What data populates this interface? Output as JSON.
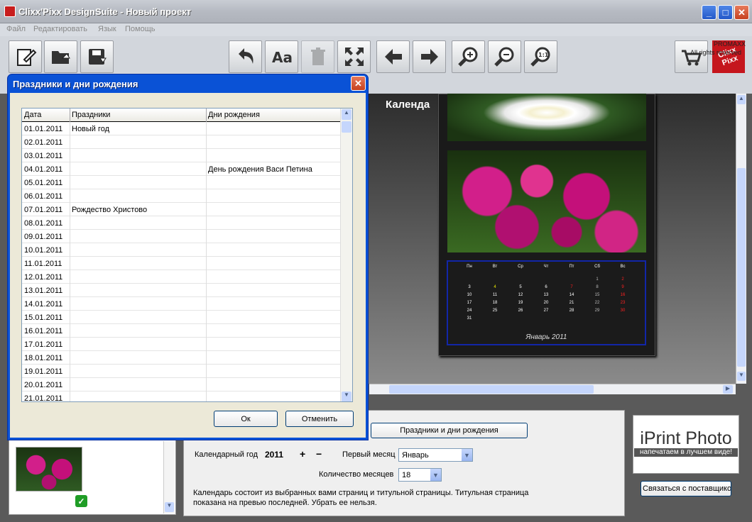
{
  "window": {
    "title": "Clixx'Pixx DesignSuite - Новый проект"
  },
  "menu": [
    "Файл",
    "Редактировать",
    "Язык",
    "Помощь"
  ],
  "brand": {
    "logo_text": "Clixx Pixx",
    "company": "PROMAXX",
    "rights": "All rights reserved"
  },
  "preview": {
    "heading": "Календа",
    "weekdays": [
      "Пн",
      "Вт",
      "Ср",
      "Чт",
      "Пт",
      "Сб",
      "Вс"
    ],
    "weeks": [
      [
        "",
        "",
        "",
        "",
        "",
        "1",
        "2"
      ],
      [
        "3",
        "4",
        "5",
        "6",
        "7",
        "8",
        "9"
      ],
      [
        "10",
        "11",
        "12",
        "13",
        "14",
        "15",
        "16"
      ],
      [
        "17",
        "18",
        "19",
        "20",
        "21",
        "22",
        "23"
      ],
      [
        "24",
        "25",
        "26",
        "27",
        "28",
        "29",
        "30"
      ],
      [
        "31",
        "",
        "",
        "",
        "",
        "",
        ""
      ]
    ],
    "month_label": "Январь 2011"
  },
  "settings": {
    "holidays_button": "Праздники и дни рождения",
    "year_label": "Календарный год",
    "year_value": "2011",
    "plus": "+",
    "minus": "−",
    "first_month_label": "Первый месяц",
    "first_month_value": "Январь",
    "months_count_label": "Количество месяцев",
    "months_count_value": "18",
    "info_text": "Календарь состоит из выбранных вами страниц и титульной страницы. Титульная страница показана на превью последней. Убрать ее нельзя."
  },
  "supplier": {
    "logo": "iPrint Photo",
    "tagline": "напечатаем в лучшем виде!",
    "contact_button": "Связаться с поставщиком"
  },
  "dialog": {
    "title": "Праздники и дни рождения",
    "columns": [
      "Дата",
      "Праздники",
      "Дни рождения"
    ],
    "rows": [
      [
        "01.01.2011",
        "Новый год",
        ""
      ],
      [
        "02.01.2011",
        "",
        ""
      ],
      [
        "03.01.2011",
        "",
        ""
      ],
      [
        "04.01.2011",
        "",
        "День рождения Васи Петина"
      ],
      [
        "05.01.2011",
        "",
        ""
      ],
      [
        "06.01.2011",
        "",
        ""
      ],
      [
        "07.01.2011",
        "Рождество Христово",
        ""
      ],
      [
        "08.01.2011",
        "",
        ""
      ],
      [
        "09.01.2011",
        "",
        ""
      ],
      [
        "10.01.2011",
        "",
        ""
      ],
      [
        "11.01.2011",
        "",
        ""
      ],
      [
        "12.01.2011",
        "",
        ""
      ],
      [
        "13.01.2011",
        "",
        ""
      ],
      [
        "14.01.2011",
        "",
        ""
      ],
      [
        "15.01.2011",
        "",
        ""
      ],
      [
        "16.01.2011",
        "",
        ""
      ],
      [
        "17.01.2011",
        "",
        ""
      ],
      [
        "18.01.2011",
        "",
        ""
      ],
      [
        "19.01.2011",
        "",
        ""
      ],
      [
        "20.01.2011",
        "",
        ""
      ],
      [
        "21.01.2011",
        "",
        ""
      ]
    ],
    "ok": "Ок",
    "cancel": "Отменить"
  },
  "colors": {
    "titlebar": "#b6bac2",
    "dialog_border": "#0a52d6",
    "weekend_red": "#ff2020",
    "highlight_yellow": "#e8e800"
  }
}
